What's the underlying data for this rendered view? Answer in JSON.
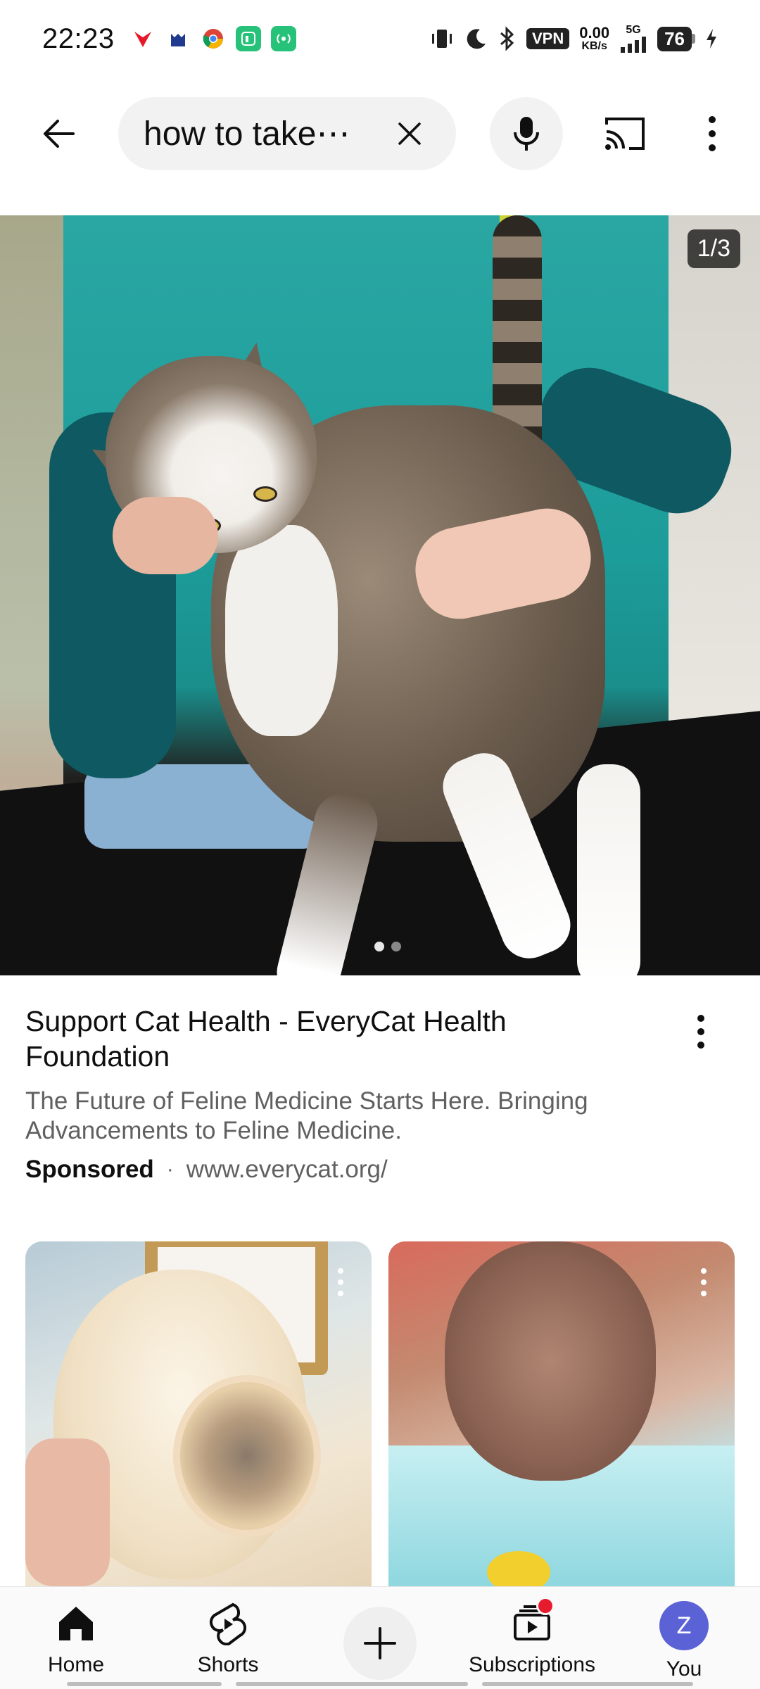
{
  "status_bar": {
    "time": "22:23",
    "vpn": "VPN",
    "speed_value": "0.00",
    "speed_unit": "KB/s",
    "network": "5G",
    "battery": "76"
  },
  "search": {
    "query": "how to take⋯"
  },
  "ad": {
    "counter": "1/3",
    "title": "Support Cat Health - EveryCat Health Foundation",
    "description": "The Future of Feline Medicine Starts Here. Bringing Advancements to Feline Medicine.",
    "sponsored_label": "Sponsored",
    "separator": "·",
    "url": "www.everycat.org/",
    "carousel_position": 1,
    "carousel_total": 3
  },
  "bottom_nav": {
    "home": "Home",
    "shorts": "Shorts",
    "subscriptions": "Subscriptions",
    "you": "You",
    "avatar_letter": "Z"
  },
  "colors": {
    "avatar_bg": "#5b62d6",
    "notification": "#e61c2e",
    "search_pill_bg": "#f2f2f2"
  }
}
